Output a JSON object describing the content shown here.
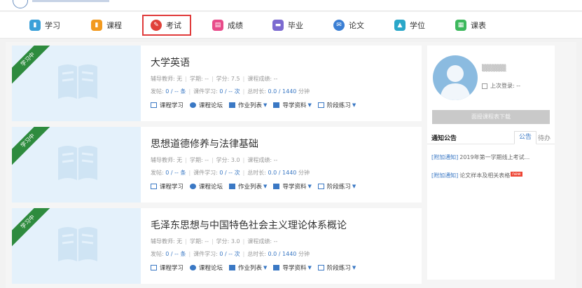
{
  "nav": {
    "items": [
      {
        "label": "学习",
        "icon": "study-icon",
        "color": "#3aa0d8"
      },
      {
        "label": "课程",
        "icon": "course-icon",
        "color": "#f29a1f"
      },
      {
        "label": "考试",
        "icon": "exam-icon",
        "color": "#e0413a"
      },
      {
        "label": "成绩",
        "icon": "grades-icon",
        "color": "#e84b8a"
      },
      {
        "label": "毕业",
        "icon": "graduation-icon",
        "color": "#7b6ad0"
      },
      {
        "label": "论文",
        "icon": "thesis-icon",
        "color": "#3b7fd4"
      },
      {
        "label": "学位",
        "icon": "degree-icon",
        "color": "#2aa7c9"
      },
      {
        "label": "课表",
        "icon": "timetable-icon",
        "color": "#3cb85c"
      }
    ],
    "active_index": 2
  },
  "courses": [
    {
      "status": "学习中",
      "title": "大学英语",
      "tutor_label": "辅导教师: 无",
      "term_label": "学期: --",
      "credit_label": "学分: 7.5",
      "score_label": "课程成绩: --",
      "posts_label": "发帖:",
      "posts_value": "0 / -- 条",
      "lessons_label": "课件学习:",
      "lessons_value": "0 / -- 次",
      "duration_label": "总时长:",
      "duration_value": "0.0 / 1440",
      "duration_unit": "分钟"
    },
    {
      "status": "学习中",
      "title": "思想道德修养与法律基础",
      "tutor_label": "辅导教师: 无",
      "term_label": "学期: --",
      "credit_label": "学分: 3.0",
      "score_label": "课程成绩: --",
      "posts_label": "发帖:",
      "posts_value": "0 / -- 条",
      "lessons_label": "课件学习:",
      "lessons_value": "0 / -- 次",
      "duration_label": "总时长:",
      "duration_value": "0.0 / 1440",
      "duration_unit": "分钟"
    },
    {
      "status": "学习中",
      "title": "毛泽东思想与中国特色社会主义理论体系概论",
      "tutor_label": "辅导教师: 无",
      "term_label": "学期: --",
      "credit_label": "学分: 3.0",
      "score_label": "课程成绩: --",
      "posts_label": "发帖:",
      "posts_value": "0 / -- 条",
      "lessons_label": "课件学习:",
      "lessons_value": "0 / -- 次",
      "duration_label": "总时长:",
      "duration_value": "0.0 / 1440",
      "duration_unit": "分钟"
    }
  ],
  "course_links": {
    "study": "课程学习",
    "forum": "课程论坛",
    "homework": "作业列表",
    "materials": "导学资料",
    "practice": "阶段练习"
  },
  "sidebar": {
    "username": "▒▒▒▒▒",
    "last_login": "上次登录: --",
    "download_button": "面授课程表下载",
    "notice_title": "通知公告",
    "tab_notice": "公告",
    "tab_todo": "待办",
    "notices": [
      {
        "tag": "[附加通知]",
        "text": "2019年第一学期线上考试...",
        "new": false
      },
      {
        "tag": "[附加通知]",
        "text": "论文样本及相关表格",
        "new": true,
        "new_label": "new"
      }
    ]
  }
}
